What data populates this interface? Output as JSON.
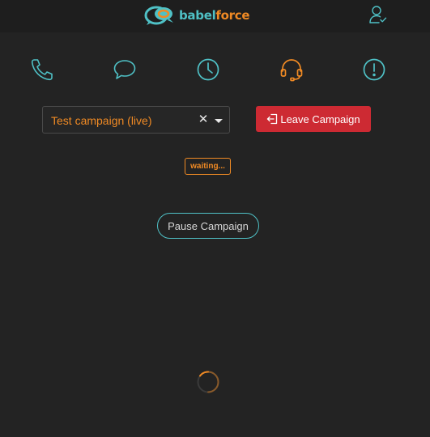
{
  "header": {
    "logo_babel": "babel",
    "logo_force": "force",
    "logo_icon": "speech-bubbles-logo",
    "user_icon": "user-check-icon"
  },
  "nav": {
    "items": [
      {
        "icon": "phone-icon",
        "color": "#4fc1c6",
        "active": false
      },
      {
        "icon": "chat-bubble-icon",
        "color": "#4fc1c6",
        "active": false
      },
      {
        "icon": "clock-icon",
        "color": "#4fc1c6",
        "active": false
      },
      {
        "icon": "headset-icon",
        "color": "#f08a24",
        "active": true
      },
      {
        "icon": "alert-icon",
        "color": "#4fc1c6",
        "active": false
      }
    ]
  },
  "campaign": {
    "selected": "Test campaign (live)",
    "clear_symbol": "✕",
    "leave_label": "Leave Campaign",
    "status": "waiting...",
    "pause_label": "Pause Campaign"
  },
  "colors": {
    "teal": "#4fc1c6",
    "orange": "#f08a24",
    "red": "#cd2a33",
    "background": "#232323"
  }
}
